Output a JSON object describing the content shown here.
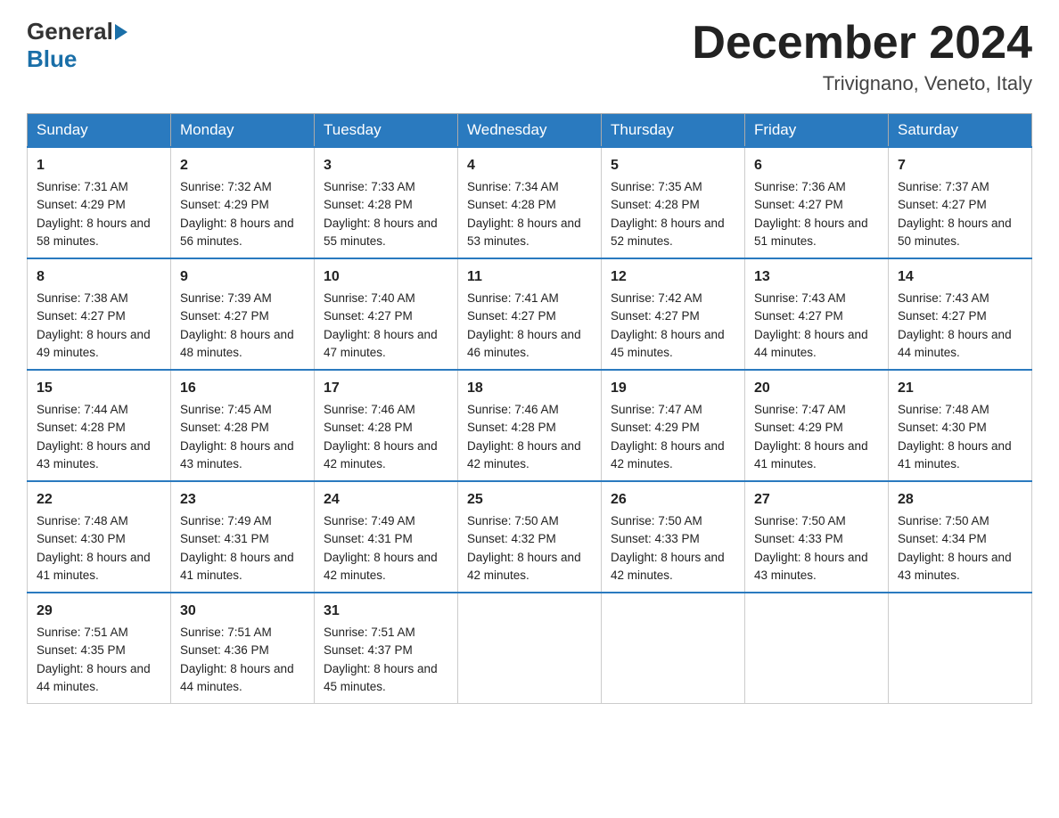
{
  "header": {
    "logo_general": "General",
    "logo_blue": "Blue",
    "month_title": "December 2024",
    "location": "Trivignano, Veneto, Italy"
  },
  "days_of_week": [
    "Sunday",
    "Monday",
    "Tuesday",
    "Wednesday",
    "Thursday",
    "Friday",
    "Saturday"
  ],
  "weeks": [
    [
      {
        "day": "1",
        "sunrise": "7:31 AM",
        "sunset": "4:29 PM",
        "daylight": "8 hours and 58 minutes."
      },
      {
        "day": "2",
        "sunrise": "7:32 AM",
        "sunset": "4:29 PM",
        "daylight": "8 hours and 56 minutes."
      },
      {
        "day": "3",
        "sunrise": "7:33 AM",
        "sunset": "4:28 PM",
        "daylight": "8 hours and 55 minutes."
      },
      {
        "day": "4",
        "sunrise": "7:34 AM",
        "sunset": "4:28 PM",
        "daylight": "8 hours and 53 minutes."
      },
      {
        "day": "5",
        "sunrise": "7:35 AM",
        "sunset": "4:28 PM",
        "daylight": "8 hours and 52 minutes."
      },
      {
        "day": "6",
        "sunrise": "7:36 AM",
        "sunset": "4:27 PM",
        "daylight": "8 hours and 51 minutes."
      },
      {
        "day": "7",
        "sunrise": "7:37 AM",
        "sunset": "4:27 PM",
        "daylight": "8 hours and 50 minutes."
      }
    ],
    [
      {
        "day": "8",
        "sunrise": "7:38 AM",
        "sunset": "4:27 PM",
        "daylight": "8 hours and 49 minutes."
      },
      {
        "day": "9",
        "sunrise": "7:39 AM",
        "sunset": "4:27 PM",
        "daylight": "8 hours and 48 minutes."
      },
      {
        "day": "10",
        "sunrise": "7:40 AM",
        "sunset": "4:27 PM",
        "daylight": "8 hours and 47 minutes."
      },
      {
        "day": "11",
        "sunrise": "7:41 AM",
        "sunset": "4:27 PM",
        "daylight": "8 hours and 46 minutes."
      },
      {
        "day": "12",
        "sunrise": "7:42 AM",
        "sunset": "4:27 PM",
        "daylight": "8 hours and 45 minutes."
      },
      {
        "day": "13",
        "sunrise": "7:43 AM",
        "sunset": "4:27 PM",
        "daylight": "8 hours and 44 minutes."
      },
      {
        "day": "14",
        "sunrise": "7:43 AM",
        "sunset": "4:27 PM",
        "daylight": "8 hours and 44 minutes."
      }
    ],
    [
      {
        "day": "15",
        "sunrise": "7:44 AM",
        "sunset": "4:28 PM",
        "daylight": "8 hours and 43 minutes."
      },
      {
        "day": "16",
        "sunrise": "7:45 AM",
        "sunset": "4:28 PM",
        "daylight": "8 hours and 43 minutes."
      },
      {
        "day": "17",
        "sunrise": "7:46 AM",
        "sunset": "4:28 PM",
        "daylight": "8 hours and 42 minutes."
      },
      {
        "day": "18",
        "sunrise": "7:46 AM",
        "sunset": "4:28 PM",
        "daylight": "8 hours and 42 minutes."
      },
      {
        "day": "19",
        "sunrise": "7:47 AM",
        "sunset": "4:29 PM",
        "daylight": "8 hours and 42 minutes."
      },
      {
        "day": "20",
        "sunrise": "7:47 AM",
        "sunset": "4:29 PM",
        "daylight": "8 hours and 41 minutes."
      },
      {
        "day": "21",
        "sunrise": "7:48 AM",
        "sunset": "4:30 PM",
        "daylight": "8 hours and 41 minutes."
      }
    ],
    [
      {
        "day": "22",
        "sunrise": "7:48 AM",
        "sunset": "4:30 PM",
        "daylight": "8 hours and 41 minutes."
      },
      {
        "day": "23",
        "sunrise": "7:49 AM",
        "sunset": "4:31 PM",
        "daylight": "8 hours and 41 minutes."
      },
      {
        "day": "24",
        "sunrise": "7:49 AM",
        "sunset": "4:31 PM",
        "daylight": "8 hours and 42 minutes."
      },
      {
        "day": "25",
        "sunrise": "7:50 AM",
        "sunset": "4:32 PM",
        "daylight": "8 hours and 42 minutes."
      },
      {
        "day": "26",
        "sunrise": "7:50 AM",
        "sunset": "4:33 PM",
        "daylight": "8 hours and 42 minutes."
      },
      {
        "day": "27",
        "sunrise": "7:50 AM",
        "sunset": "4:33 PM",
        "daylight": "8 hours and 43 minutes."
      },
      {
        "day": "28",
        "sunrise": "7:50 AM",
        "sunset": "4:34 PM",
        "daylight": "8 hours and 43 minutes."
      }
    ],
    [
      {
        "day": "29",
        "sunrise": "7:51 AM",
        "sunset": "4:35 PM",
        "daylight": "8 hours and 44 minutes."
      },
      {
        "day": "30",
        "sunrise": "7:51 AM",
        "sunset": "4:36 PM",
        "daylight": "8 hours and 44 minutes."
      },
      {
        "day": "31",
        "sunrise": "7:51 AM",
        "sunset": "4:37 PM",
        "daylight": "8 hours and 45 minutes."
      },
      null,
      null,
      null,
      null
    ]
  ],
  "labels": {
    "sunrise": "Sunrise:",
    "sunset": "Sunset:",
    "daylight": "Daylight:"
  }
}
